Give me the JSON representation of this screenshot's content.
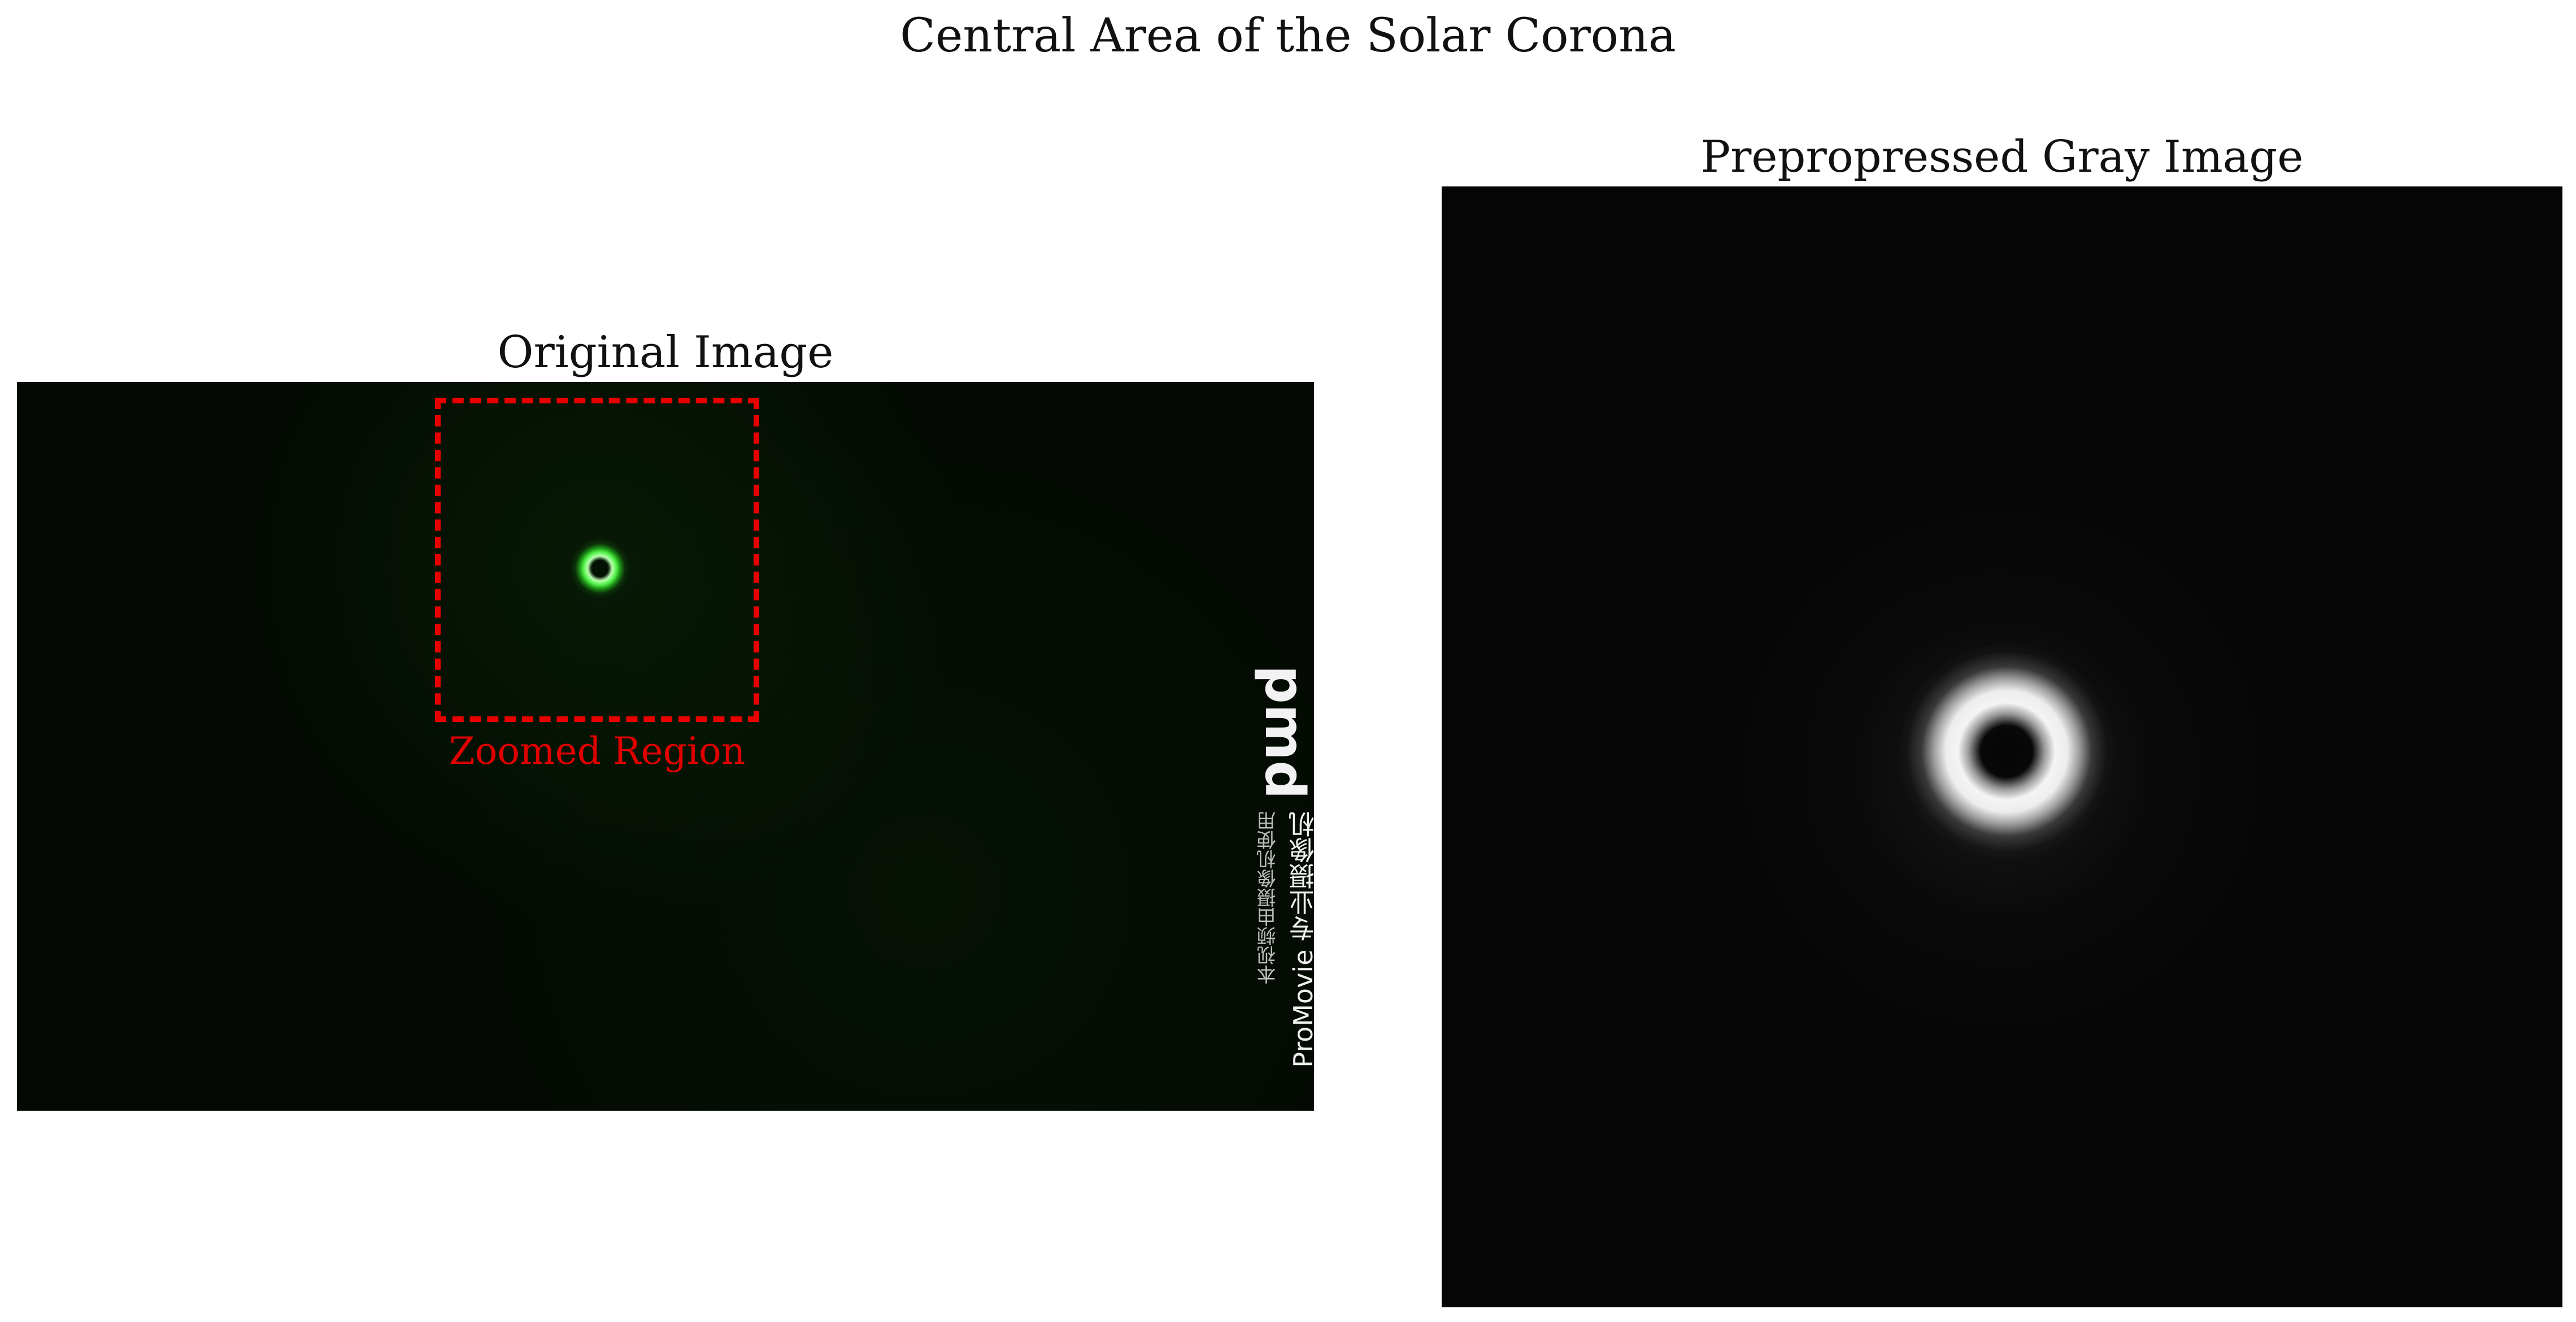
{
  "figure": {
    "title": "Central Area of the Solar Corona"
  },
  "left_panel": {
    "title": "Original Image",
    "zoom_label": "Zoomed Region",
    "zoom_box_color": "#e80000",
    "watermark_logo_text": "pmd",
    "watermark_line1": "ProMovie 专业摄像机",
    "watermark_line2": "本视频由摄像机使用"
  },
  "right_panel": {
    "title": "Prepropressed Gray Image"
  },
  "colors": {
    "corona_green": "#4ff047",
    "corona_gray": "#f4f4f4"
  }
}
